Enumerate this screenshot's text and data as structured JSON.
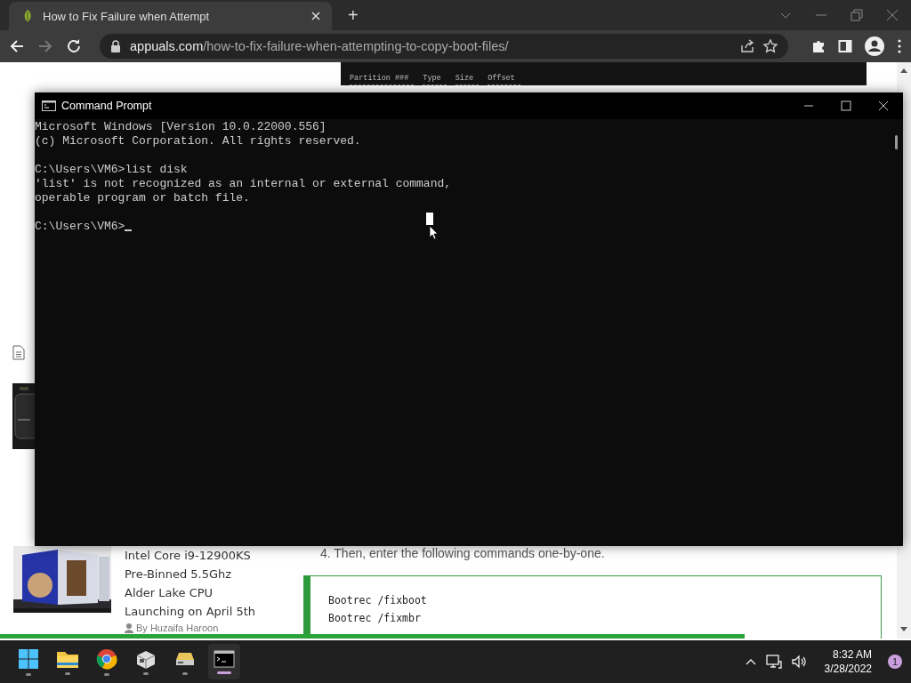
{
  "browser": {
    "tab": {
      "title": "How to Fix Failure when Attempt",
      "selected": true
    },
    "new_tab": "+",
    "forward_disabled": true,
    "url": {
      "domain": "appuals.com",
      "path": "/how-to-fix-failure-when-attempting-to-copy-boot-files/"
    }
  },
  "page": {
    "partition_columns": [
      "Partition ###",
      "Type",
      "Size",
      "Offset"
    ],
    "related_article": {
      "title": "Intel Core i9-12900KS Pre-Binned 5.5Ghz Alder Lake CPU Launching on April 5th",
      "author": "By Huzaifa Haroon"
    },
    "step": "4. Then, enter the following commands one-by-one.",
    "code_lines": [
      "Bootrec /fixboot",
      "Bootrec /fixmbr"
    ],
    "reading_progress": {
      "level": 0.817
    }
  },
  "command_prompt": {
    "title": "Command Prompt",
    "blocks": [
      [
        "Microsoft Windows [Version 10.0.22000.556]",
        "(c) Microsoft Corporation. All rights reserved."
      ],
      [
        "C:\\Users\\VM6>list disk",
        "'list' is not recognized as an internal or external command,",
        "operable program or batch file."
      ]
    ],
    "prompt": "C:\\Users\\VM6>"
  },
  "taskbar": {
    "apps": [
      {
        "kind": "start",
        "active": false
      },
      {
        "kind": "files",
        "active": false
      },
      {
        "kind": "browser",
        "active": false
      },
      {
        "kind": "package",
        "active": false
      },
      {
        "kind": "installer",
        "active": false
      },
      {
        "kind": "terminal",
        "active": true
      }
    ],
    "time": "8:32 AM",
    "date": "3/28/2022",
    "notifications": "1"
  }
}
